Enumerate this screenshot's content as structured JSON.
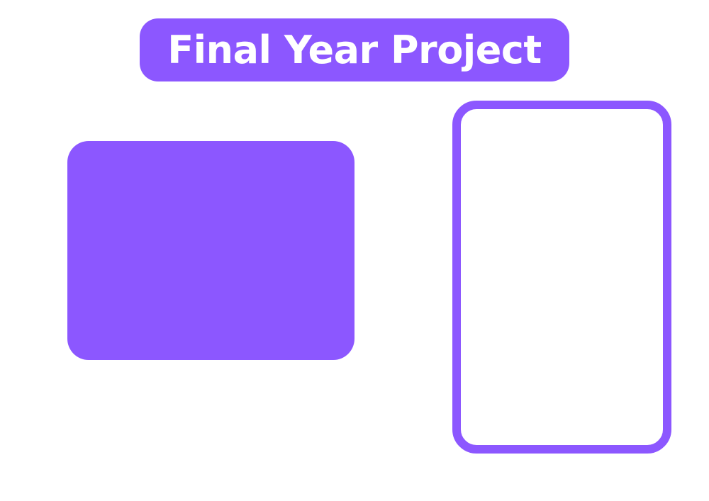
{
  "title": {
    "text": "Final Year Project"
  },
  "colors": {
    "accent": "#8c57ff",
    "background": "#ffffff",
    "title_text": "#ffffff"
  },
  "panels": {
    "left": {
      "style": "filled"
    },
    "right": {
      "style": "outlined"
    }
  }
}
